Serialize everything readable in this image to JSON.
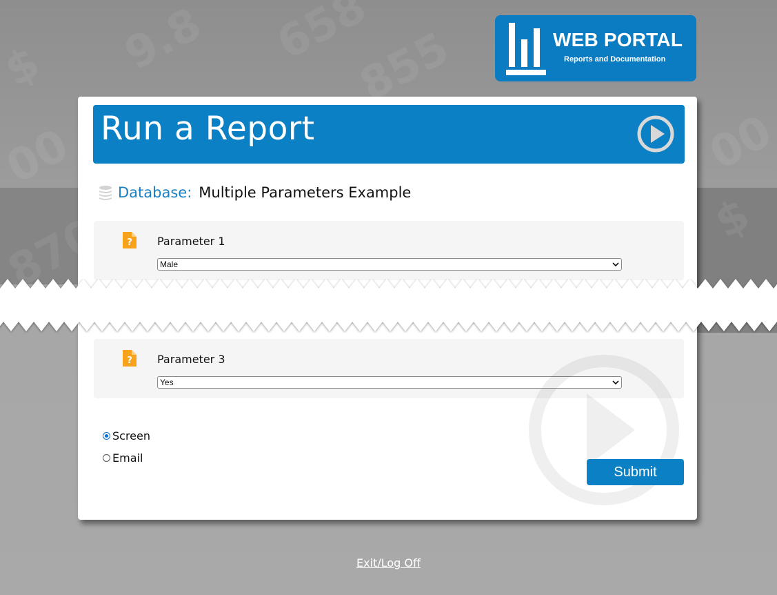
{
  "logo": {
    "title": "WEB PORTAL",
    "subtitle": "Reports and Documentation"
  },
  "background": {
    "numbers": [
      "9.8",
      "658",
      "855",
      "00",
      "870",
      "00",
      "$",
      "$"
    ]
  },
  "card": {
    "title": "Run a Report",
    "header_icon": "play-circle-icon",
    "database_label": "Database:",
    "database_name": "Multiple Parameters Example"
  },
  "parameters": [
    {
      "label": "Parameter 1",
      "selected": "Male",
      "icon": "file-question-icon"
    },
    {
      "label": "Parameter 3",
      "selected": "Yes",
      "icon": "file-question-icon"
    }
  ],
  "output": {
    "options": [
      {
        "label": "Screen",
        "checked": true
      },
      {
        "label": "Email",
        "checked": false
      }
    ]
  },
  "submit_label": "Submit",
  "exit_label": "Exit/Log Off",
  "colors": {
    "brand_blue": "#0b80c4",
    "param_icon_orange": "#f7a21b",
    "background_gray": "#a6a6a6"
  }
}
